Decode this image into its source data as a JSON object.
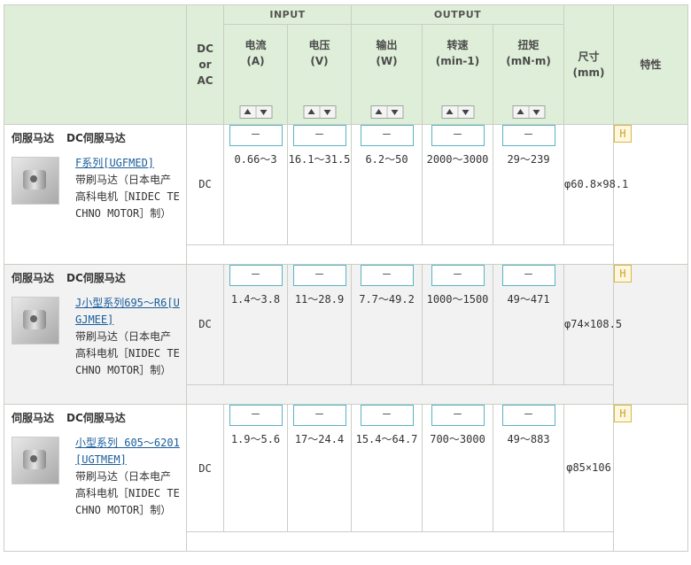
{
  "header": {
    "input_group": "INPUT",
    "output_group": "OUTPUT",
    "dc_or_ac": [
      "DC",
      "or",
      "AC"
    ],
    "current": [
      "电流",
      "(A)"
    ],
    "voltage": [
      "电压",
      "(V)"
    ],
    "output": [
      "输出",
      "(W)"
    ],
    "speed": [
      "转速",
      "(min-1)"
    ],
    "torque": [
      "扭矩",
      "(mN·m)"
    ],
    "size": [
      "尺寸",
      "(mm)"
    ],
    "feature": "特性"
  },
  "filter_placeholder": "－",
  "products": [
    {
      "category": "伺服马达",
      "subcategory": "DC伺服马达",
      "link": "F系列[UGFMED]",
      "description": "带刷马达（日本电产高科电机［NIDEC TECHNO MOTOR］制）",
      "dc_ac": "DC",
      "current": "0.66～3",
      "voltage": "16.1～31.5",
      "output": "6.2～50",
      "speed": "2000～3000",
      "torque": "29～239",
      "size": "φ60.8×98.1",
      "feature": "H"
    },
    {
      "category": "伺服马达",
      "subcategory": "DC伺服马达",
      "link": "J小型系列695～R6[UGJMEE]",
      "description": "带刷马达（日本电产高科电机［NIDEC TECHNO MOTOR］制）",
      "dc_ac": "DC",
      "current": "1.4～3.8",
      "voltage": "11～28.9",
      "output": "7.7～49.2",
      "speed": "1000～1500",
      "torque": "49～471",
      "size": "φ74×108.5",
      "feature": "H"
    },
    {
      "category": "伺服马达",
      "subcategory": "DC伺服马达",
      "link": "小型系列 605～6201[UGTMEM]",
      "description": "带刷马达（日本电产高科电机［NIDEC TECHNO MOTOR］制）",
      "dc_ac": "DC",
      "current": "1.9～5.6",
      "voltage": "17～24.4",
      "output": "15.4～64.7",
      "speed": "700～3000",
      "torque": "49～883",
      "size": "φ85×106",
      "feature": "H"
    }
  ]
}
